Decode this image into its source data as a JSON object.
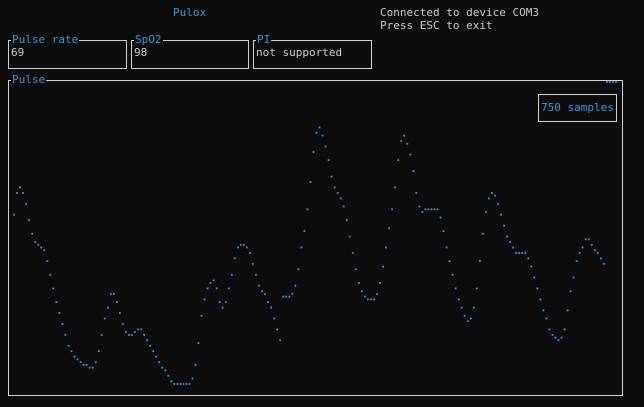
{
  "window": {
    "title": "Pulox",
    "status_line_1": "Connected to device COM3",
    "status_line_2": "Press ESC to exit"
  },
  "readouts": {
    "pulse_rate": {
      "label": "Pulse rate",
      "value": "69"
    },
    "spo2": {
      "label": "SpO2",
      "value": "98"
    },
    "pi": {
      "label": "PI",
      "value": "not supported"
    }
  },
  "pulse_panel": {
    "label": "Pulse",
    "samples_label": "750 samples"
  },
  "colors": {
    "accent": "#3a96dd",
    "text": "#cccccc",
    "border": "#d0d0d0",
    "background": "#0c0c0c"
  },
  "chart_data": {
    "type": "scatter",
    "title": "Pulse",
    "x": [
      0,
      1,
      2,
      3,
      4,
      5,
      6,
      7,
      8,
      9,
      10,
      11,
      12,
      13,
      14,
      15,
      16,
      17,
      18,
      19,
      20,
      21,
      22,
      23,
      24,
      25,
      26,
      27,
      28,
      29,
      30,
      31,
      32,
      33,
      34,
      35,
      36,
      37,
      38,
      39,
      40,
      41,
      42,
      43,
      44,
      45,
      46,
      47,
      48,
      49,
      50,
      51,
      52,
      53,
      54,
      55,
      56,
      57,
      58,
      59,
      60,
      61,
      62,
      63,
      64,
      65,
      66,
      67,
      68,
      69,
      70,
      71,
      72,
      73,
      74,
      75,
      76,
      77,
      78,
      79,
      80,
      81,
      82,
      83,
      84,
      85,
      86,
      87,
      88,
      89,
      90,
      91,
      92,
      93,
      94,
      95,
      96,
      97,
      98,
      99,
      100,
      101,
      102,
      103,
      104,
      105,
      106,
      107,
      108,
      109,
      110,
      111,
      112,
      113,
      114,
      115,
      116,
      117,
      118,
      119,
      120,
      121,
      122,
      123,
      124,
      125,
      126,
      127,
      128,
      129,
      130,
      131,
      132,
      133,
      134,
      135,
      136,
      137,
      138,
      139,
      140,
      141,
      142,
      143,
      144,
      145,
      146,
      147,
      148,
      149,
      150,
      151,
      152,
      153,
      154,
      155,
      156,
      157,
      158,
      159,
      160,
      161,
      162,
      163,
      164,
      165,
      166,
      167,
      168,
      169,
      170,
      171,
      172,
      173,
      174,
      175,
      176,
      177,
      178,
      179,
      180,
      181,
      182,
      183,
      184,
      185,
      186,
      187,
      188,
      189,
      190,
      191,
      192,
      193,
      194,
      195,
      196,
      197,
      198,
      199
    ],
    "values": [
      62,
      70,
      72,
      70,
      66,
      60,
      55,
      52,
      51,
      50,
      49,
      45,
      40,
      35,
      30,
      26,
      22,
      18,
      14,
      12,
      10,
      9,
      8,
      7,
      7,
      6,
      6,
      8,
      12,
      18,
      24,
      28,
      33,
      33,
      30,
      26,
      22,
      19,
      18,
      18,
      19,
      20,
      20,
      18,
      16,
      14,
      12,
      10,
      8,
      6,
      5,
      3,
      1,
      0,
      0,
      0,
      0,
      0,
      0,
      2,
      7,
      15,
      25,
      31,
      35,
      37,
      38,
      35,
      30,
      28,
      30,
      35,
      40,
      46,
      50,
      51,
      51,
      50,
      48,
      44,
      40,
      36,
      34,
      33,
      30,
      28,
      24,
      20,
      16,
      32,
      32,
      32,
      33,
      36,
      42,
      50,
      56,
      64,
      74,
      85,
      92,
      94,
      91,
      87,
      82,
      76,
      72,
      70,
      68,
      65,
      60,
      54,
      48,
      42,
      37,
      34,
      32,
      31,
      31,
      31,
      33,
      37,
      43,
      50,
      57,
      64,
      72,
      82,
      89,
      91,
      88,
      84,
      78,
      70,
      65,
      63,
      64,
      64,
      64,
      64,
      64,
      61,
      56,
      50,
      45,
      40,
      35,
      31,
      28,
      25,
      23,
      24,
      28,
      35,
      45,
      55,
      63,
      68,
      70,
      69,
      66,
      62,
      58,
      54,
      52,
      50,
      48,
      48,
      48,
      48,
      46,
      43,
      39,
      35,
      31,
      27,
      24,
      20,
      18,
      17,
      16,
      17,
      20,
      27,
      34,
      39,
      45,
      48,
      50,
      53,
      53,
      51,
      49,
      48,
      46,
      44
    ],
    "ylim": [
      0,
      100
    ]
  }
}
